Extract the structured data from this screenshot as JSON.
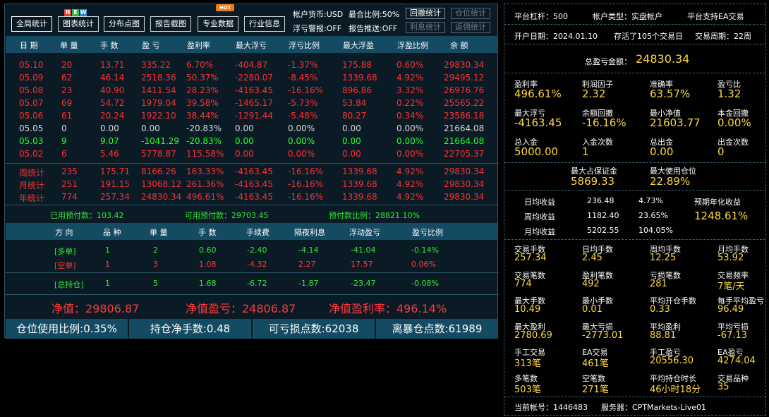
{
  "toolbar": {
    "buttons": [
      "全局统计",
      "图表统计",
      "分布点图",
      "报告截图",
      "专业数据",
      "行业信息"
    ],
    "new_letters": [
      "N",
      "E",
      "W"
    ],
    "hot_badge": "HOT",
    "account_currency": "帐户货币:USD",
    "max_ratio": "最合比例:50%",
    "float_alert": "浮亏警报:OFF",
    "report_push": "报告推送:OFF",
    "btn_withdraw": "回撤统计",
    "btn_position": "仓位统计",
    "btn_interest": "利息统计",
    "btn_rebate": "返佣统计",
    "colors": {
      "new_n": "#e8402c",
      "new_e": "#34b34a",
      "new_w": "#2d84d4",
      "hot": "#f07b15"
    }
  },
  "daily_table": {
    "headers": [
      "日 期",
      "单 量",
      "手 数",
      "盈 亏",
      "盈利率",
      "最大浮亏",
      "浮亏比例",
      "最大浮盈",
      "浮盈比例",
      "余 额"
    ],
    "rows": [
      {
        "date": "05.10",
        "orders": "20",
        "lots": "13.71",
        "pnl": "335.22",
        "rate": "6.70%",
        "max_float_loss": "-404.87",
        "float_loss_ratio": "-1.37%",
        "max_float_profit": "175.88",
        "float_profit_ratio": "0.60%",
        "balance": "29830.34",
        "tone": "red"
      },
      {
        "date": "05.09",
        "orders": "62",
        "lots": "46.14",
        "pnl": "2518.36",
        "rate": "50.37%",
        "max_float_loss": "-2280.07",
        "float_loss_ratio": "-8.45%",
        "max_float_profit": "1339.68",
        "float_profit_ratio": "4.92%",
        "balance": "29495.12",
        "tone": "red"
      },
      {
        "date": "05.08",
        "orders": "23",
        "lots": "40.90",
        "pnl": "1411.54",
        "rate": "28.23%",
        "max_float_loss": "-4163.45",
        "float_loss_ratio": "-16.16%",
        "max_float_profit": "896.86",
        "float_profit_ratio": "3.32%",
        "balance": "26976.76",
        "tone": "red"
      },
      {
        "date": "05.07",
        "orders": "69",
        "lots": "54.72",
        "pnl": "1979.04",
        "rate": "39.58%",
        "max_float_loss": "-1465.17",
        "float_loss_ratio": "-5.73%",
        "max_float_profit": "53.84",
        "float_profit_ratio": "0.22%",
        "balance": "25565.22",
        "tone": "red"
      },
      {
        "date": "05.06",
        "orders": "61",
        "lots": "20.24",
        "pnl": "1922.10",
        "rate": "38.44%",
        "max_float_loss": "-1291.44",
        "float_loss_ratio": "-5.48%",
        "max_float_profit": "80.27",
        "float_profit_ratio": "0.34%",
        "balance": "23586.18",
        "tone": "red"
      },
      {
        "date": "05.05",
        "orders": "0",
        "lots": "0.00",
        "pnl": "0.00",
        "rate": "-20.83%",
        "max_float_loss": "0.00",
        "float_loss_ratio": "0.00%",
        "max_float_profit": "0.00",
        "float_profit_ratio": "0.00%",
        "balance": "21664.08",
        "tone": "white"
      },
      {
        "date": "05.03",
        "orders": "9",
        "lots": "9.07",
        "pnl": "-1041.29",
        "rate": "-20.83%",
        "max_float_loss": "0.00",
        "float_loss_ratio": "0.00%",
        "max_float_profit": "0.00",
        "float_profit_ratio": "0.00%",
        "balance": "21664.08",
        "tone": "green"
      },
      {
        "date": "05.02",
        "orders": "6",
        "lots": "5.46",
        "pnl": "5778.87",
        "rate": "115.58%",
        "max_float_loss": "0.00",
        "float_loss_ratio": "0.00%",
        "max_float_profit": "0.00",
        "float_profit_ratio": "0.00%",
        "balance": "22705.37",
        "tone": "red"
      }
    ],
    "summary": [
      {
        "date": "周统计",
        "orders": "235",
        "lots": "175.71",
        "pnl": "8166.26",
        "rate": "163.33%",
        "max_float_loss": "-4163.45",
        "float_loss_ratio": "-16.16%",
        "max_float_profit": "1339.68",
        "float_profit_ratio": "4.92%",
        "balance": "29830.34"
      },
      {
        "date": "月统计",
        "orders": "251",
        "lots": "191.15",
        "pnl": "13068.12",
        "rate": "261.36%",
        "max_float_loss": "-4163.45",
        "float_loss_ratio": "-16.16%",
        "max_float_profit": "1339.68",
        "float_profit_ratio": "4.92%",
        "balance": "29830.34"
      },
      {
        "date": "年统计",
        "orders": "774",
        "lots": "257.34",
        "pnl": "24830.34",
        "rate": "496.61%",
        "max_float_loss": "-4163.45",
        "float_loss_ratio": "-16.16%",
        "max_float_profit": "1339.68",
        "float_profit_ratio": "4.92%",
        "balance": "29830.34"
      }
    ]
  },
  "margin": {
    "used": "已用预付款：103.42",
    "available": "可用预付款：29703.45",
    "ratio": "预付款比例：28821.10%"
  },
  "position_table": {
    "headers": [
      "方 向",
      "品 种",
      "单 量",
      "手 数",
      "手续费",
      "隔夜利息",
      "浮动盈亏",
      "盈亏比例"
    ],
    "rows": [
      {
        "dir": "[多单]",
        "sym": "1",
        "orders": "2",
        "lots": "0.60",
        "fee": "-2.40",
        "swap": "-4.14",
        "float": "-41.04",
        "ratio": "-0.14%",
        "tone": "green"
      },
      {
        "dir": "[空单]",
        "sym": "1",
        "orders": "3",
        "lots": "1.08",
        "fee": "-4.32",
        "swap": "2.27",
        "float": "17.57",
        "ratio": "0.06%",
        "tone": "red"
      }
    ],
    "total": {
      "dir": "[总持仓]",
      "sym": "1",
      "orders": "5",
      "lots": "1.68",
      "fee": "-6.72",
      "swap": "-1.87",
      "float": "-23.47",
      "ratio": "-0.08%"
    }
  },
  "net": {
    "net_value": "净值：29806.87",
    "net_pnl": "净值盈亏：24806.87",
    "net_rate": "净值盈利率：496.14%"
  },
  "bottom_bar": [
    "仓位使用比例:0.35%",
    "持仓净手数:0.48",
    "可亏损点数:62038",
    "离暴仓点数:61989"
  ],
  "right": {
    "leverage": "平台杠杆：500",
    "account_type": "帐户类型：实盘帐户",
    "ea_support": "平台支持EA交易",
    "open_date": "开户日期：2024.01.10",
    "survived": "存活了105个交易日",
    "cycle": "交易周期：22周",
    "total_pnl_label": "总盈亏金额：",
    "total_pnl": "24830.34",
    "grid1": [
      {
        "label": "盈利率",
        "value": "496.61%"
      },
      {
        "label": "利润因子",
        "value": "2.32"
      },
      {
        "label": "准确率",
        "value": "63.57%"
      },
      {
        "label": "盈亏比",
        "value": "1.32"
      },
      {
        "label": "最大浮亏",
        "value": "-4163.45"
      },
      {
        "label": "余额回撤",
        "value": "-16.16%"
      },
      {
        "label": "最小净值",
        "value": "21603.77"
      },
      {
        "label": "本金回撤",
        "value": "0.00%"
      },
      {
        "label": "总入金",
        "value": "5000.00"
      },
      {
        "label": "入金次数",
        "value": "1"
      },
      {
        "label": "总出金",
        "value": "0.00"
      },
      {
        "label": "出金次数",
        "value": "0"
      }
    ],
    "max_margin_label": "最大占保证金",
    "max_margin": "5869.33",
    "max_pos_label": "最大使用仓位",
    "max_pos": "22.89%",
    "returns": [
      {
        "label": "日均收益",
        "amount": "236.48",
        "pct": "4.73%"
      },
      {
        "label": "周均收益",
        "amount": "1182.40",
        "pct": "23.65%"
      },
      {
        "label": "月均收益",
        "amount": "5202.55",
        "pct": "104.05%"
      }
    ],
    "annual_label": "预期年化收益",
    "annual": "1248.61%",
    "grid2": [
      {
        "label": "交易手数",
        "value": "257.34"
      },
      {
        "label": "日均手数",
        "value": "2.45"
      },
      {
        "label": "周均手数",
        "value": "12.25"
      },
      {
        "label": "月均手数",
        "value": "53.92"
      },
      {
        "label": "交易笔数",
        "value": "774"
      },
      {
        "label": "盈利笔数",
        "value": "492"
      },
      {
        "label": "亏损笔数",
        "value": "281"
      },
      {
        "label": "交易频率",
        "value": "7笔/天"
      },
      {
        "label": "最大手数",
        "value": "10.49"
      },
      {
        "label": "最小手数",
        "value": "0.01"
      },
      {
        "label": "平均开仓手数",
        "value": "0.33"
      },
      {
        "label": "每手平均盈亏",
        "value": "96.49"
      },
      {
        "label": "最大盈利",
        "value": "2780.69"
      },
      {
        "label": "最大亏损",
        "value": "-2773.01"
      },
      {
        "label": "平均盈利",
        "value": "88.81"
      },
      {
        "label": "平均亏损",
        "value": "-67.13"
      },
      {
        "label": "手工交易",
        "value": "313笔"
      },
      {
        "label": "EA交易",
        "value": "461笔"
      },
      {
        "label": "手工盈亏",
        "value": "20556.30"
      },
      {
        "label": "EA盈亏",
        "value": "4274.04"
      },
      {
        "label": "多笔数",
        "value": "503笔"
      },
      {
        "label": "空笔数",
        "value": "271笔"
      },
      {
        "label": "平均持仓时长",
        "value": "46小时18分"
      },
      {
        "label": "交易品种",
        "value": "35"
      }
    ],
    "account_no": "当前帐号：1446483",
    "server": "服务器：CPTMarkets-Live01"
  }
}
